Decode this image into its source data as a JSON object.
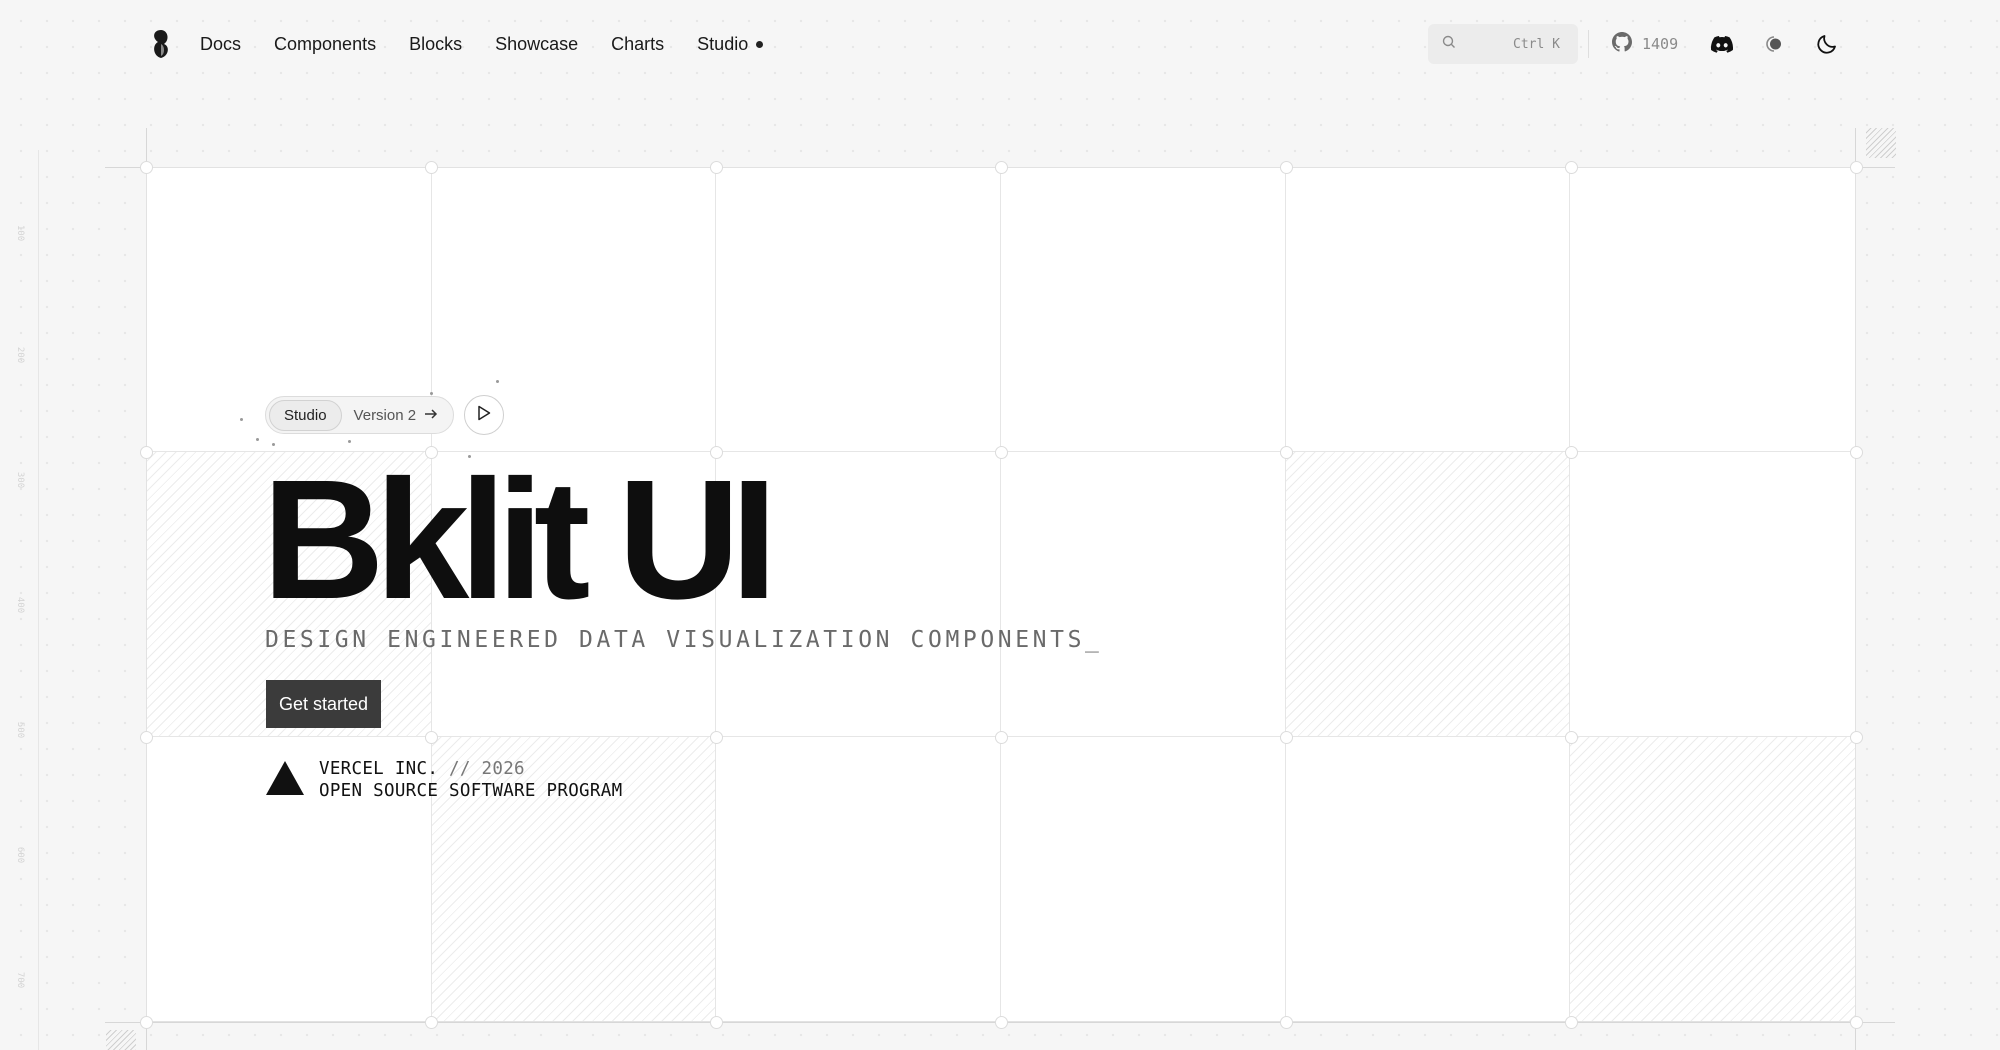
{
  "nav": {
    "items": [
      {
        "label": "Docs"
      },
      {
        "label": "Components"
      },
      {
        "label": "Blocks"
      },
      {
        "label": "Showcase"
      },
      {
        "label": "Charts"
      },
      {
        "label": "Studio"
      }
    ]
  },
  "search": {
    "shortcut": "Ctrl K"
  },
  "github": {
    "stars": "1409"
  },
  "hero": {
    "pill_tag": "Studio",
    "pill_version": "Version 2",
    "title": "Bklit UI",
    "subtitle": "DESIGN ENGINEERED DATA VISUALIZATION COMPONENTS_",
    "cta": "Get started",
    "org": "VERCEL INC.",
    "org_sep": " // 2026",
    "program": "OPEN SOURCE SOFTWARE PROGRAM"
  },
  "ruler": {
    "labels": [
      "100",
      "200",
      "300",
      "400",
      "500",
      "600",
      "700"
    ]
  },
  "icons": {
    "logo": "bklit-logo-icon",
    "search": "search-icon",
    "github": "github-icon",
    "discord": "discord-icon",
    "contrast": "contrast-icon",
    "theme": "moon-icon",
    "play": "play-icon",
    "arrow": "arrow-right-icon",
    "vercel": "vercel-triangle-icon"
  },
  "colors": {
    "background": "#f6f6f6",
    "cta": "#3b3b3b",
    "text": "#0e0e0e"
  }
}
